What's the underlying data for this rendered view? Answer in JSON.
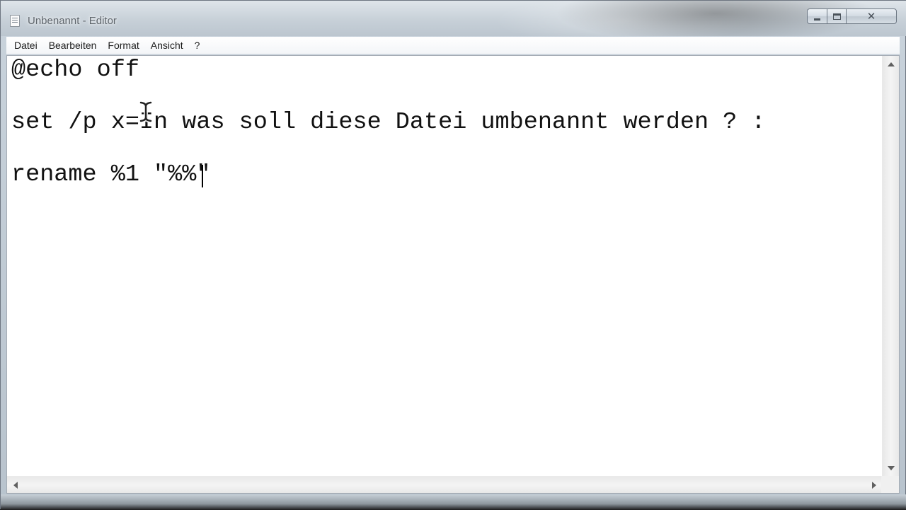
{
  "window": {
    "title": "Unbenannt - Editor"
  },
  "caption_buttons": {
    "minimize_icon": "minimize-icon",
    "maximize_icon": "maximize-icon",
    "close_icon": "close-icon",
    "close_glyph": "✕"
  },
  "menu": {
    "items": [
      {
        "label": "Datei"
      },
      {
        "label": "Bearbeiten"
      },
      {
        "label": "Format"
      },
      {
        "label": "Ansicht"
      },
      {
        "label": "?"
      }
    ]
  },
  "editor": {
    "lines": [
      "@echo off",
      "set /p x=In was soll diese Datei umbenannt werden ? :",
      "rename %1 \"%%\""
    ]
  },
  "colors": {
    "text": "#111111",
    "editor_background": "#ffffff",
    "frame": "#c9d3dc"
  }
}
